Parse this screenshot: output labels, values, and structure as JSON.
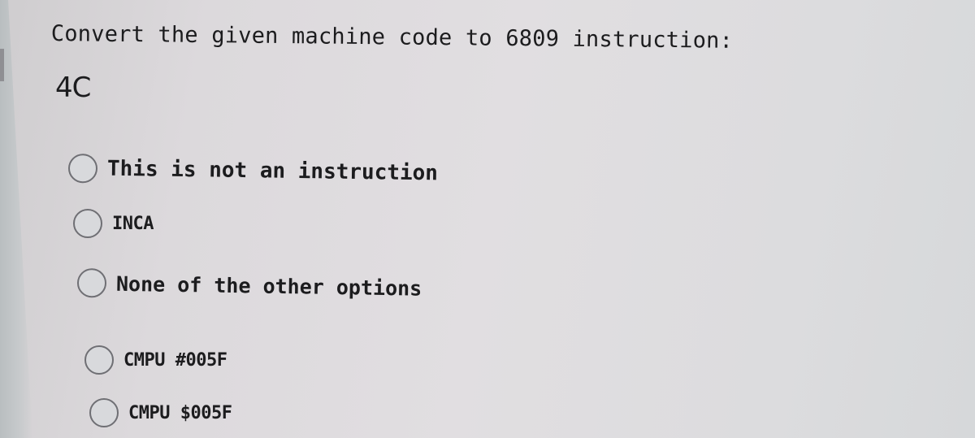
{
  "question": {
    "prompt": "Convert the given machine code to 6809 instruction:",
    "machine_code": "4C"
  },
  "options": [
    {
      "label": "This is not an instruction",
      "selected": false
    },
    {
      "label": "INCA",
      "selected": false
    },
    {
      "label": "None of the other options",
      "selected": false
    },
    {
      "label": "CMPU #005F",
      "selected": false
    },
    {
      "label": "CMPU $005F",
      "selected": false
    }
  ]
}
